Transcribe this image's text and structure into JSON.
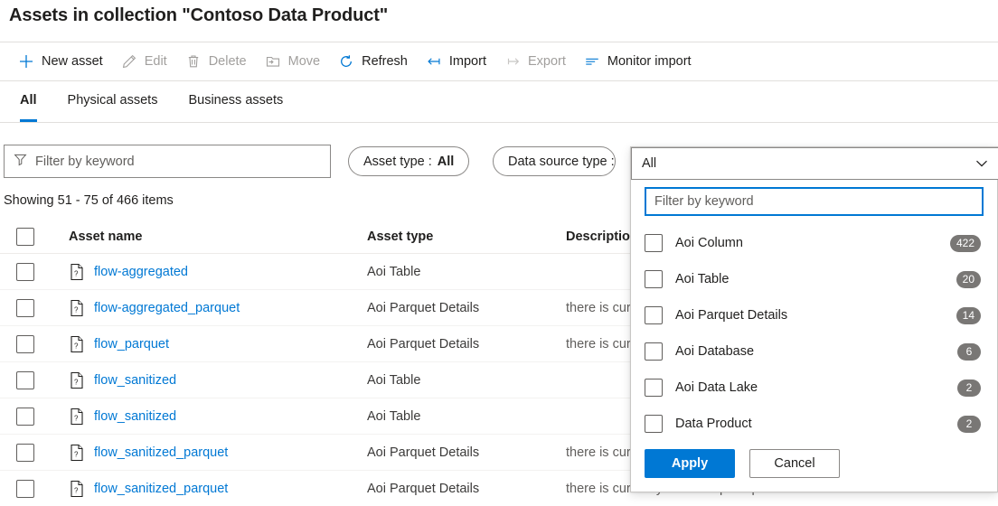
{
  "header": {
    "title": "Assets in collection \"Contoso Data Product\""
  },
  "toolbar": {
    "items": [
      {
        "label": "New asset",
        "icon": "plus-icon",
        "disabled": false
      },
      {
        "label": "Edit",
        "icon": "pencil-icon",
        "disabled": true
      },
      {
        "label": "Delete",
        "icon": "trash-icon",
        "disabled": true
      },
      {
        "label": "Move",
        "icon": "move-folder-icon",
        "disabled": true
      },
      {
        "label": "Refresh",
        "icon": "refresh-icon",
        "disabled": false
      },
      {
        "label": "Import",
        "icon": "import-arrow-icon",
        "disabled": false
      },
      {
        "label": "Export",
        "icon": "export-arrow-icon",
        "disabled": true
      },
      {
        "label": "Monitor import",
        "icon": "monitor-lines-icon",
        "disabled": false
      }
    ]
  },
  "tabs": [
    {
      "label": "All",
      "selected": true
    },
    {
      "label": "Physical assets",
      "selected": false
    },
    {
      "label": "Business assets",
      "selected": false
    }
  ],
  "filters": {
    "keyword_placeholder": "Filter by keyword",
    "keyword_value": "",
    "asset_type": {
      "label": "Asset type :",
      "value": "All"
    },
    "data_source_type": {
      "label": "Data source type :",
      "value": "All"
    }
  },
  "results": {
    "showing": "Showing 51 - 75 of 466 items"
  },
  "table": {
    "columns": [
      "Asset name",
      "Asset type",
      "Description"
    ],
    "rows": [
      {
        "name": "flow-aggregated",
        "type": "Aoi Table",
        "description": ""
      },
      {
        "name": "flow-aggregated_parquet",
        "type": "Aoi Parquet Details",
        "description": "there is currently no description provided..."
      },
      {
        "name": "flow_parquet",
        "type": "Aoi Parquet Details",
        "description": "there is currently no description provided..."
      },
      {
        "name": "flow_sanitized",
        "type": "Aoi Table",
        "description": ""
      },
      {
        "name": "flow_sanitized",
        "type": "Aoi Table",
        "description": ""
      },
      {
        "name": "flow_sanitized_parquet",
        "type": "Aoi Parquet Details",
        "description": "there is currently no description provided..."
      },
      {
        "name": "flow_sanitized_parquet",
        "type": "Aoi Parquet Details",
        "description": "there is currently no description provided..."
      }
    ]
  },
  "dropdown": {
    "selected_value": "All",
    "search_placeholder": "Filter by keyword",
    "search_value": "",
    "options": [
      {
        "label": "Aoi Column",
        "count": "422",
        "checked": false
      },
      {
        "label": "Aoi Table",
        "count": "20",
        "checked": false
      },
      {
        "label": "Aoi Parquet Details",
        "count": "14",
        "checked": false
      },
      {
        "label": "Aoi Database",
        "count": "6",
        "checked": false
      },
      {
        "label": "Aoi Data Lake",
        "count": "2",
        "checked": false
      },
      {
        "label": "Data Product",
        "count": "2",
        "checked": false
      }
    ],
    "apply_label": "Apply",
    "cancel_label": "Cancel"
  },
  "colors": {
    "accent": "#0078d4",
    "link": "#0078d4",
    "badge": "#797775",
    "disabled_text": "#a19f9d"
  }
}
